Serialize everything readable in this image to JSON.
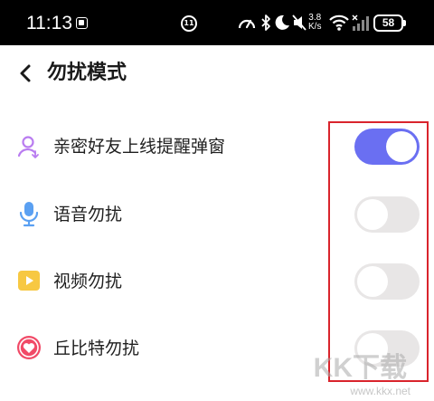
{
  "status_bar": {
    "time": "11:13",
    "notification_count": "11",
    "net_speed_value": "3.8",
    "net_speed_unit": "K/s",
    "battery": "58",
    "icons": [
      "app-icon",
      "speedometer-icon",
      "bluetooth-icon",
      "do-not-disturb-moon-icon",
      "mute-icon",
      "wifi-icon",
      "signal-icon"
    ]
  },
  "header": {
    "title": "勿扰模式",
    "back_icon": "chevron-left-icon"
  },
  "settings": [
    {
      "label": "亲密好友上线提醒弹窗",
      "icon": "friend-user-icon",
      "enabled": true
    },
    {
      "label": "语音勿扰",
      "icon": "microphone-icon",
      "enabled": false
    },
    {
      "label": "视频勿扰",
      "icon": "video-play-icon",
      "enabled": false
    },
    {
      "label": "丘比特勿扰",
      "icon": "heart-icon",
      "enabled": false
    }
  ],
  "colors": {
    "toggle_on": "#6a6ff2",
    "toggle_off": "#e8e6e6",
    "highlight": "#d9242c"
  },
  "watermark": {
    "text": "KK下载",
    "url": "www.kkx.net"
  }
}
